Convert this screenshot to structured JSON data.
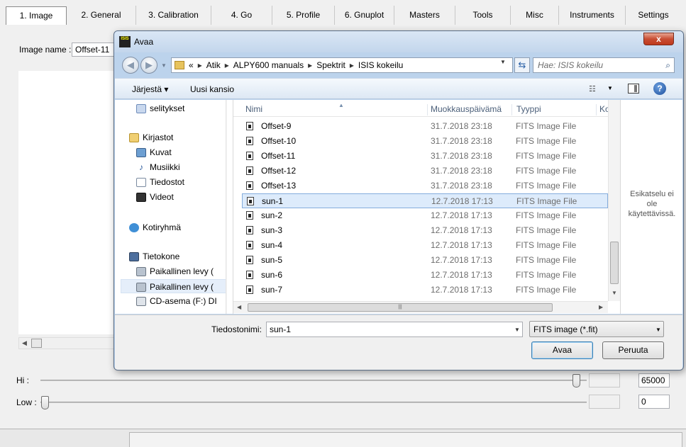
{
  "app": {
    "tabs": [
      "1. Image",
      "2. General",
      "3. Calibration",
      "4. Go",
      "5. Profile",
      "6. Gnuplot",
      "Masters",
      "Tools",
      "Misc",
      "Instruments",
      "Settings"
    ],
    "image_name_label": "Image name :",
    "image_name_value": "Offset-11",
    "hi_label": "Hi :",
    "low_label": "Low :",
    "hi_value": "65000",
    "low_value": "0"
  },
  "dialog": {
    "title": "Avaa",
    "close_label": "x",
    "app_icon_label": "ISIS",
    "breadcrumb": [
      "«",
      "Atik",
      "ALPY600 manuals",
      "Spektrit",
      "ISIS kokeilu"
    ],
    "search_placeholder": "Hae: ISIS kokeilu",
    "toolbar": {
      "organize": "Järjestä ▾",
      "new_folder": "Uusi kansio"
    },
    "nav_items": [
      {
        "label": "selitykset",
        "icon": "document-icon"
      },
      {
        "label": "Kirjastot",
        "icon": "libraries-icon"
      },
      {
        "label": "Kuvat",
        "icon": "pictures-icon"
      },
      {
        "label": "Musiikki",
        "icon": "music-icon"
      },
      {
        "label": "Tiedostot",
        "icon": "documents-icon"
      },
      {
        "label": "Videot",
        "icon": "videos-icon"
      },
      {
        "label": "Kotiryhmä",
        "icon": "homegroup-icon"
      },
      {
        "label": "Tietokone",
        "icon": "computer-icon"
      },
      {
        "label": "Paikallinen levy (",
        "icon": "drive-icon"
      },
      {
        "label": "Paikallinen levy (",
        "icon": "drive-icon"
      },
      {
        "label": "CD-asema (F:) DI",
        "icon": "cd-drive-icon"
      }
    ],
    "columns": {
      "name": "Nimi",
      "date": "Muokkauspäivämä",
      "type": "Tyyppi",
      "size": "Ko"
    },
    "files": [
      {
        "name": "Offset-9",
        "date": "31.7.2018 23:18",
        "type": "FITS Image File"
      },
      {
        "name": "Offset-10",
        "date": "31.7.2018 23:18",
        "type": "FITS Image File"
      },
      {
        "name": "Offset-11",
        "date": "31.7.2018 23:18",
        "type": "FITS Image File"
      },
      {
        "name": "Offset-12",
        "date": "31.7.2018 23:18",
        "type": "FITS Image File"
      },
      {
        "name": "Offset-13",
        "date": "31.7.2018 23:18",
        "type": "FITS Image File"
      },
      {
        "name": "sun-1",
        "date": "12.7.2018 17:13",
        "type": "FITS Image File"
      },
      {
        "name": "sun-2",
        "date": "12.7.2018 17:13",
        "type": "FITS Image File"
      },
      {
        "name": "sun-3",
        "date": "12.7.2018 17:13",
        "type": "FITS Image File"
      },
      {
        "name": "sun-4",
        "date": "12.7.2018 17:13",
        "type": "FITS Image File"
      },
      {
        "name": "sun-5",
        "date": "12.7.2018 17:13",
        "type": "FITS Image File"
      },
      {
        "name": "sun-6",
        "date": "12.7.2018 17:13",
        "type": "FITS Image File"
      },
      {
        "name": "sun-7",
        "date": "12.7.2018 17:13",
        "type": "FITS Image File"
      }
    ],
    "selected_file": "sun-1",
    "preview_text_1": "Esikatselu ei",
    "preview_text_2": "ole",
    "preview_text_3": "käytettävissä.",
    "filename_label": "Tiedostonimi:",
    "filename_value": "sun-1",
    "filetype_value": "FITS image (*.fit)",
    "open_label": "Avaa",
    "cancel_label": "Peruuta"
  },
  "colors": {
    "selection": "#ddebfb",
    "selection_border": "#84acdd",
    "dialog_frame": "#bcd3ec",
    "close_red": "#c84d33"
  }
}
